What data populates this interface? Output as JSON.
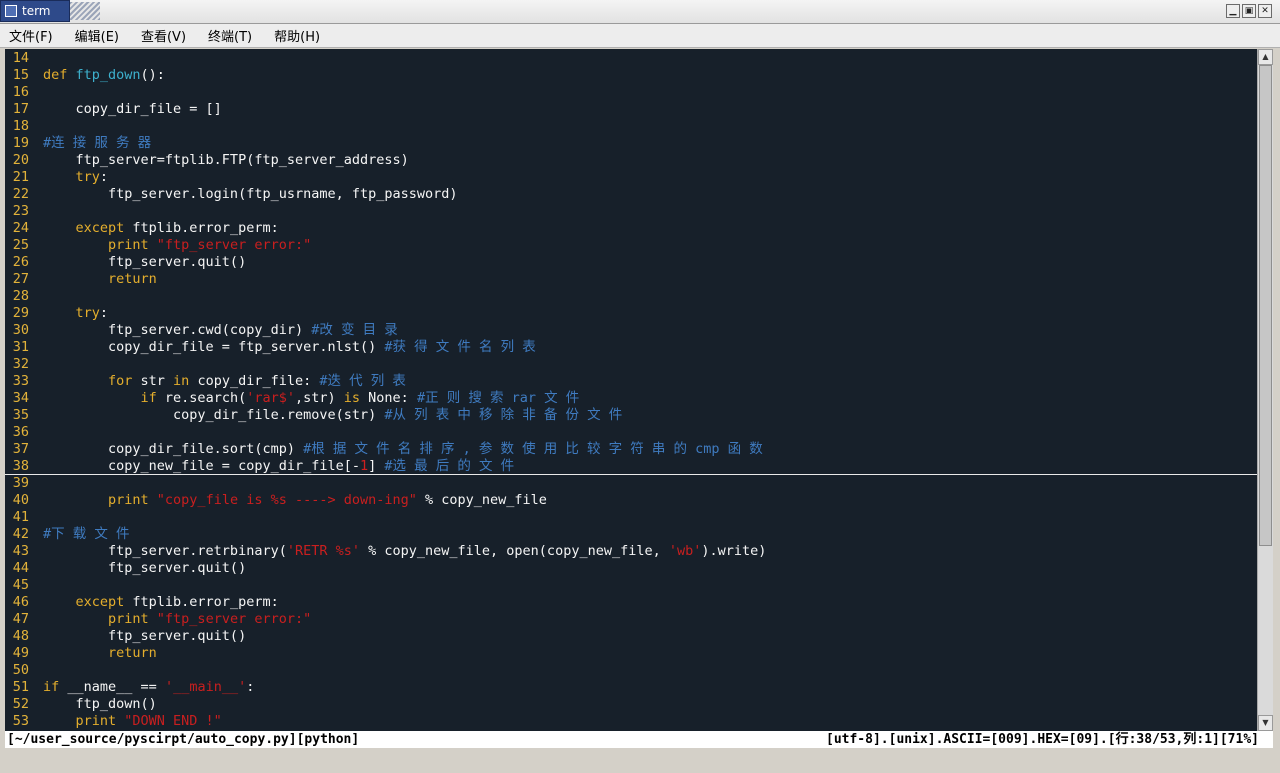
{
  "window": {
    "title": "term",
    "buttons": {
      "minimize": "▁",
      "maximize": "▣",
      "close": "✕"
    }
  },
  "menu": [
    "文件(F)",
    "编辑(E)",
    "查看(V)",
    "终端(T)",
    "帮助(H)"
  ],
  "colors": {
    "background": "#17202a",
    "line_number": "#e3b33a",
    "keyword": "#e4ae2d",
    "function": "#3db0cd",
    "string": "#c91f1f",
    "comment": "#3f7bc0",
    "text": "#f5f5f5"
  },
  "editor": {
    "cursor_line": 38,
    "lines": [
      {
        "n": "14",
        "tokens": []
      },
      {
        "n": "15",
        "tokens": [
          [
            "kw",
            "def "
          ],
          [
            "fn",
            "ftp_down"
          ],
          [
            "norm",
            "():"
          ]
        ]
      },
      {
        "n": "16",
        "tokens": []
      },
      {
        "n": "17",
        "tokens": [
          [
            "norm",
            "    copy_dir_file = []"
          ]
        ]
      },
      {
        "n": "18",
        "tokens": []
      },
      {
        "n": "19",
        "tokens": [
          [
            "cm",
            "#连 接 服 务 器"
          ]
        ]
      },
      {
        "n": "20",
        "tokens": [
          [
            "norm",
            "    ftp_server=ftplib.FTP(ftp_server_address)"
          ]
        ]
      },
      {
        "n": "21",
        "tokens": [
          [
            "kw",
            "    try"
          ],
          [
            "norm",
            ":"
          ]
        ]
      },
      {
        "n": "22",
        "tokens": [
          [
            "norm",
            "        ftp_server.login(ftp_usrname, ftp_password)"
          ]
        ]
      },
      {
        "n": "23",
        "tokens": []
      },
      {
        "n": "24",
        "tokens": [
          [
            "kw",
            "    except"
          ],
          [
            "norm",
            " ftplib.error_perm:"
          ]
        ]
      },
      {
        "n": "25",
        "tokens": [
          [
            "kw",
            "        print "
          ],
          [
            "str",
            "\"ftp_server error:\""
          ]
        ]
      },
      {
        "n": "26",
        "tokens": [
          [
            "norm",
            "        ftp_server.quit()"
          ]
        ]
      },
      {
        "n": "27",
        "tokens": [
          [
            "kw",
            "        return"
          ]
        ]
      },
      {
        "n": "28",
        "tokens": []
      },
      {
        "n": "29",
        "tokens": [
          [
            "kw",
            "    try"
          ],
          [
            "norm",
            ":"
          ]
        ]
      },
      {
        "n": "30",
        "tokens": [
          [
            "norm",
            "        ftp_server.cwd(copy_dir) "
          ],
          [
            "cm",
            "#改 变 目 录"
          ]
        ]
      },
      {
        "n": "31",
        "tokens": [
          [
            "norm",
            "        copy_dir_file = ftp_server.nlst() "
          ],
          [
            "cm",
            "#获 得 文 件 名 列 表"
          ]
        ]
      },
      {
        "n": "32",
        "tokens": []
      },
      {
        "n": "33",
        "tokens": [
          [
            "kw",
            "        for"
          ],
          [
            "norm",
            " str "
          ],
          [
            "kw",
            "in"
          ],
          [
            "norm",
            " copy_dir_file: "
          ],
          [
            "cm",
            "#迭 代 列 表"
          ]
        ]
      },
      {
        "n": "34",
        "tokens": [
          [
            "kw",
            "            if"
          ],
          [
            "norm",
            " re.search("
          ],
          [
            "str",
            "'rar$'"
          ],
          [
            "norm",
            ",str) "
          ],
          [
            "kw",
            "is"
          ],
          [
            "norm",
            " None: "
          ],
          [
            "cm",
            "#正 则 搜 索 rar 文 件"
          ]
        ]
      },
      {
        "n": "35",
        "tokens": [
          [
            "norm",
            "                copy_dir_file.remove(str) "
          ],
          [
            "cm",
            "#从 列 表 中 移 除 非 备 份 文 件"
          ]
        ]
      },
      {
        "n": "36",
        "tokens": []
      },
      {
        "n": "37",
        "tokens": [
          [
            "norm",
            "        copy_dir_file.sort(cmp) "
          ],
          [
            "cm",
            "#根 据 文 件 名 排 序 , 参 数 使 用 比 较 字 符 串 的 cmp 函 数"
          ]
        ]
      },
      {
        "n": "38",
        "tokens": [
          [
            "norm",
            "        copy_new_file = copy_dir_file[-"
          ],
          [
            "cur",
            "1"
          ],
          [
            "norm",
            "] "
          ],
          [
            "cm",
            "#选 最 后 的 文 件"
          ]
        ]
      },
      {
        "n": "39",
        "tokens": []
      },
      {
        "n": "40",
        "tokens": [
          [
            "kw",
            "        print "
          ],
          [
            "str",
            "\"copy_file is %s ----> down-ing\""
          ],
          [
            "norm",
            " % copy_new_file"
          ]
        ]
      },
      {
        "n": "41",
        "tokens": []
      },
      {
        "n": "42",
        "tokens": [
          [
            "cm",
            "#下 载 文 件"
          ]
        ]
      },
      {
        "n": "43",
        "tokens": [
          [
            "norm",
            "        ftp_server.retrbinary("
          ],
          [
            "str",
            "'RETR %s'"
          ],
          [
            "norm",
            " % copy_new_file, open(copy_new_file, "
          ],
          [
            "str",
            "'wb'"
          ],
          [
            "norm",
            ").write)"
          ]
        ]
      },
      {
        "n": "44",
        "tokens": [
          [
            "norm",
            "        ftp_server.quit()"
          ]
        ]
      },
      {
        "n": "45",
        "tokens": []
      },
      {
        "n": "46",
        "tokens": [
          [
            "kw",
            "    except"
          ],
          [
            "norm",
            " ftplib.error_perm:"
          ]
        ]
      },
      {
        "n": "47",
        "tokens": [
          [
            "kw",
            "        print "
          ],
          [
            "str",
            "\"ftp_server error:\""
          ]
        ]
      },
      {
        "n": "48",
        "tokens": [
          [
            "norm",
            "        ftp_server.quit()"
          ]
        ]
      },
      {
        "n": "49",
        "tokens": [
          [
            "kw",
            "        return"
          ]
        ]
      },
      {
        "n": "50",
        "tokens": []
      },
      {
        "n": "51",
        "tokens": [
          [
            "kw",
            "if"
          ],
          [
            "norm",
            " __name__ == "
          ],
          [
            "str",
            "'__main__'"
          ],
          [
            "norm",
            ":"
          ]
        ]
      },
      {
        "n": "52",
        "tokens": [
          [
            "norm",
            "    ftp_down()"
          ]
        ]
      },
      {
        "n": "53",
        "tokens": [
          [
            "kw",
            "    print "
          ],
          [
            "str",
            "\"DOWN END !\""
          ]
        ]
      }
    ]
  },
  "statusbar": {
    "left": "[~/user_source/pyscirpt/auto_copy.py][python]",
    "right": "[utf-8].[unix].ASCII=[009].HEX=[09].[行:38/53,列:1][71%]"
  },
  "scroll": {
    "position_fraction": 0.71,
    "visible_fraction": 0.74
  }
}
